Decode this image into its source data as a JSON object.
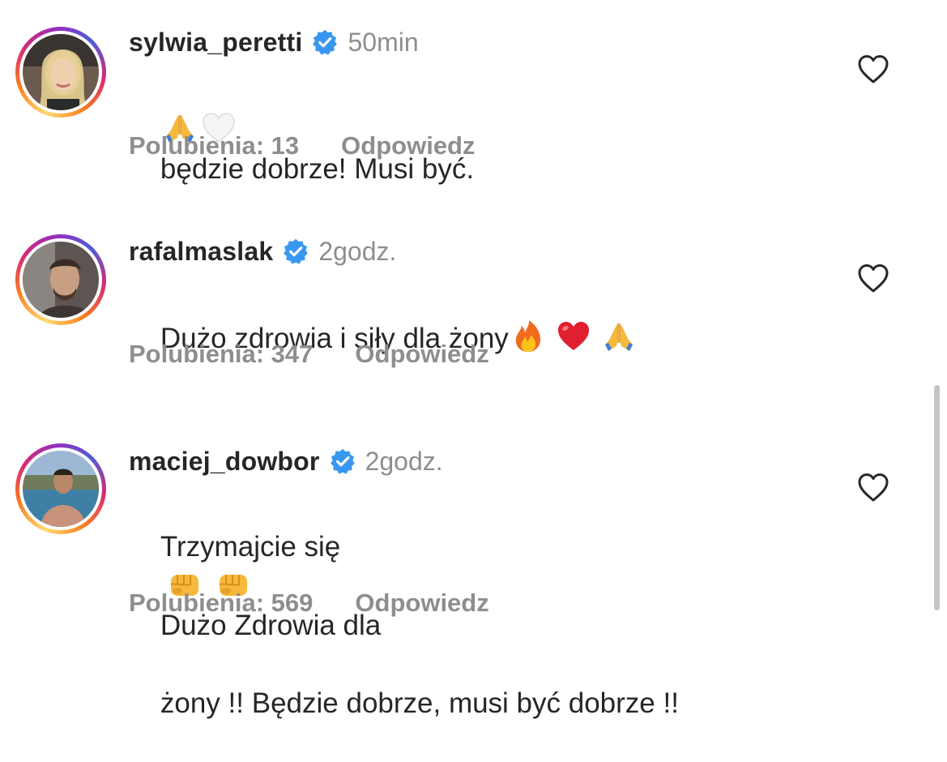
{
  "comments": [
    {
      "username": "sylwia_peretti",
      "time": "50min",
      "text_emoji_prefix": [
        "pray-emoji",
        "white-heart-emoji"
      ],
      "text": "będzie dobrze! Musi być.",
      "likes": "Polubienia: 13",
      "reply_label": "Odpowiedz",
      "verified": true
    },
    {
      "username": "rafalmaslak",
      "time": "2godz.",
      "text": "Dużo zdrowia i siły dla żony",
      "text_emoji_suffix": [
        "fire-emoji",
        "red-heart-emoji",
        "pray-emoji"
      ],
      "likes": "Polubienia: 347",
      "reply_label": "Odpowiedz",
      "verified": true
    },
    {
      "username": "maciej_dowbor",
      "time": "2godz.",
      "text_line1_pre": "Trzymajcie się",
      "text_line1_emoji": [
        "fist-emoji",
        "fist-emoji"
      ],
      "text_line1_post": "Dużo Zdrowia dla",
      "text_line2": "żony !! Będzie dobrze, musi być dobrze !!",
      "likes": "Polubienia: 569",
      "reply_label": "Odpowiedz",
      "verified": true
    }
  ],
  "colors": {
    "primary_text": "#262626",
    "secondary_text": "#8e8e8e",
    "verified_blue": "#3897f0",
    "scrollbar": "#c4c4c4"
  }
}
